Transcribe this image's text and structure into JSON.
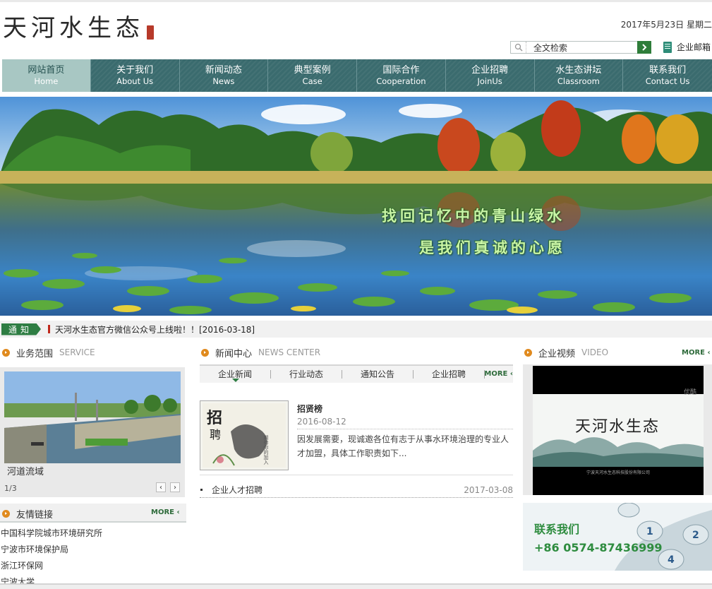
{
  "header": {
    "logo_text": "天河水生态",
    "date": "2017年5月23日  星期二",
    "search_placeholder": "全文检索",
    "mail_label": "企业邮箱"
  },
  "nav": [
    {
      "cn": "网站首页",
      "en": "Home"
    },
    {
      "cn": "关于我们",
      "en": "About Us"
    },
    {
      "cn": "新闻动态",
      "en": "News"
    },
    {
      "cn": "典型案例",
      "en": "Case"
    },
    {
      "cn": "国际合作",
      "en": "Cooperation"
    },
    {
      "cn": "企业招聘",
      "en": "JoinUs"
    },
    {
      "cn": "水生态讲坛",
      "en": "Classroom"
    },
    {
      "cn": "联系我们",
      "en": "Contact Us"
    }
  ],
  "banner": {
    "line1": "找回记忆中的青山绿水",
    "line2": "是我们真诚的心愿"
  },
  "notice": {
    "tag": "通知",
    "text": "天河水生态官方微信公众号上线啦！！[2016-03-18]"
  },
  "service": {
    "title_cn": "业务范围",
    "title_en": "SERVICE",
    "caption": "河道流域",
    "page": "1/3",
    "prev": "‹",
    "next": "›"
  },
  "links": {
    "title_cn": "友情链接",
    "more": "MORE ‹",
    "items": [
      "中国科学院城市环境研究所",
      "宁波市环境保护局",
      "浙江环保网",
      "宁波大学"
    ]
  },
  "news": {
    "title_cn": "新闻中心",
    "title_en": "NEWS CENTER",
    "tabs": [
      "企业新闻",
      "行业动态",
      "通知公告",
      "企业招聘"
    ],
    "more": "MORE ‹",
    "featured": {
      "title": "招贤榜",
      "date": "2016-08-12",
      "summary": "因发展需要，现诚邀各位有志于从事水环境治理的专业人才加盟，具体工作职责如下...",
      "thumb_big": "招聘",
      "thumb_small": "期待你的加入"
    },
    "list": [
      {
        "title": "企业人才招聘",
        "date": "2017-03-08"
      }
    ]
  },
  "video": {
    "title_cn": "企业视频",
    "title_en": "VIDEO",
    "more": "MORE ‹",
    "watermark": "优酷",
    "screen_title": "天河水生态",
    "screen_sub": "宁波天河水生态科技股份有限公司"
  },
  "contact": {
    "title": "联系我们",
    "phone": "+86 0574-87436999"
  }
}
